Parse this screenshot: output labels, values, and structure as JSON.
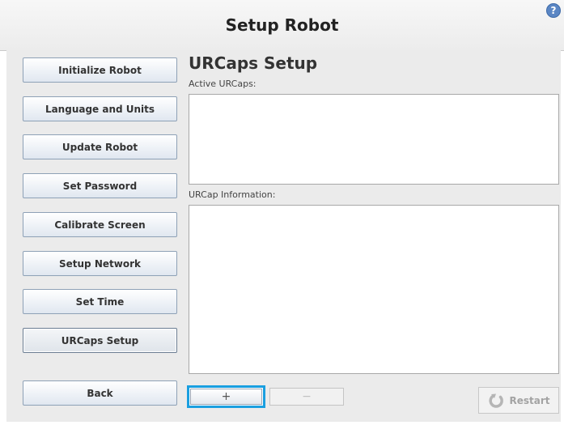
{
  "header": {
    "title": "Setup Robot",
    "help_icon": "question-circle-icon",
    "help_glyph": "?"
  },
  "sidebar": {
    "items": [
      {
        "label": "Initialize Robot",
        "active": false
      },
      {
        "label": "Language and Units",
        "active": false
      },
      {
        "label": "Update Robot",
        "active": false
      },
      {
        "label": "Set Password",
        "active": false
      },
      {
        "label": "Calibrate Screen",
        "active": false
      },
      {
        "label": "Setup Network",
        "active": false
      },
      {
        "label": "Set Time",
        "active": false
      },
      {
        "label": "URCaps Setup",
        "active": true
      }
    ],
    "back_label": "Back"
  },
  "main": {
    "title": "URCaps Setup",
    "active_label": "Active URCaps:",
    "info_label": "URCap Information:",
    "add_glyph": "+",
    "add_icon": "plus-icon",
    "remove_glyph": "−",
    "remove_icon": "minus-icon",
    "restart_label": "Restart",
    "restart_icon": "restart-icon"
  },
  "colors": {
    "accent_focus": "#1a9fe0",
    "help_icon": "#5a86c4",
    "panel_bg": "#ebebeb"
  }
}
